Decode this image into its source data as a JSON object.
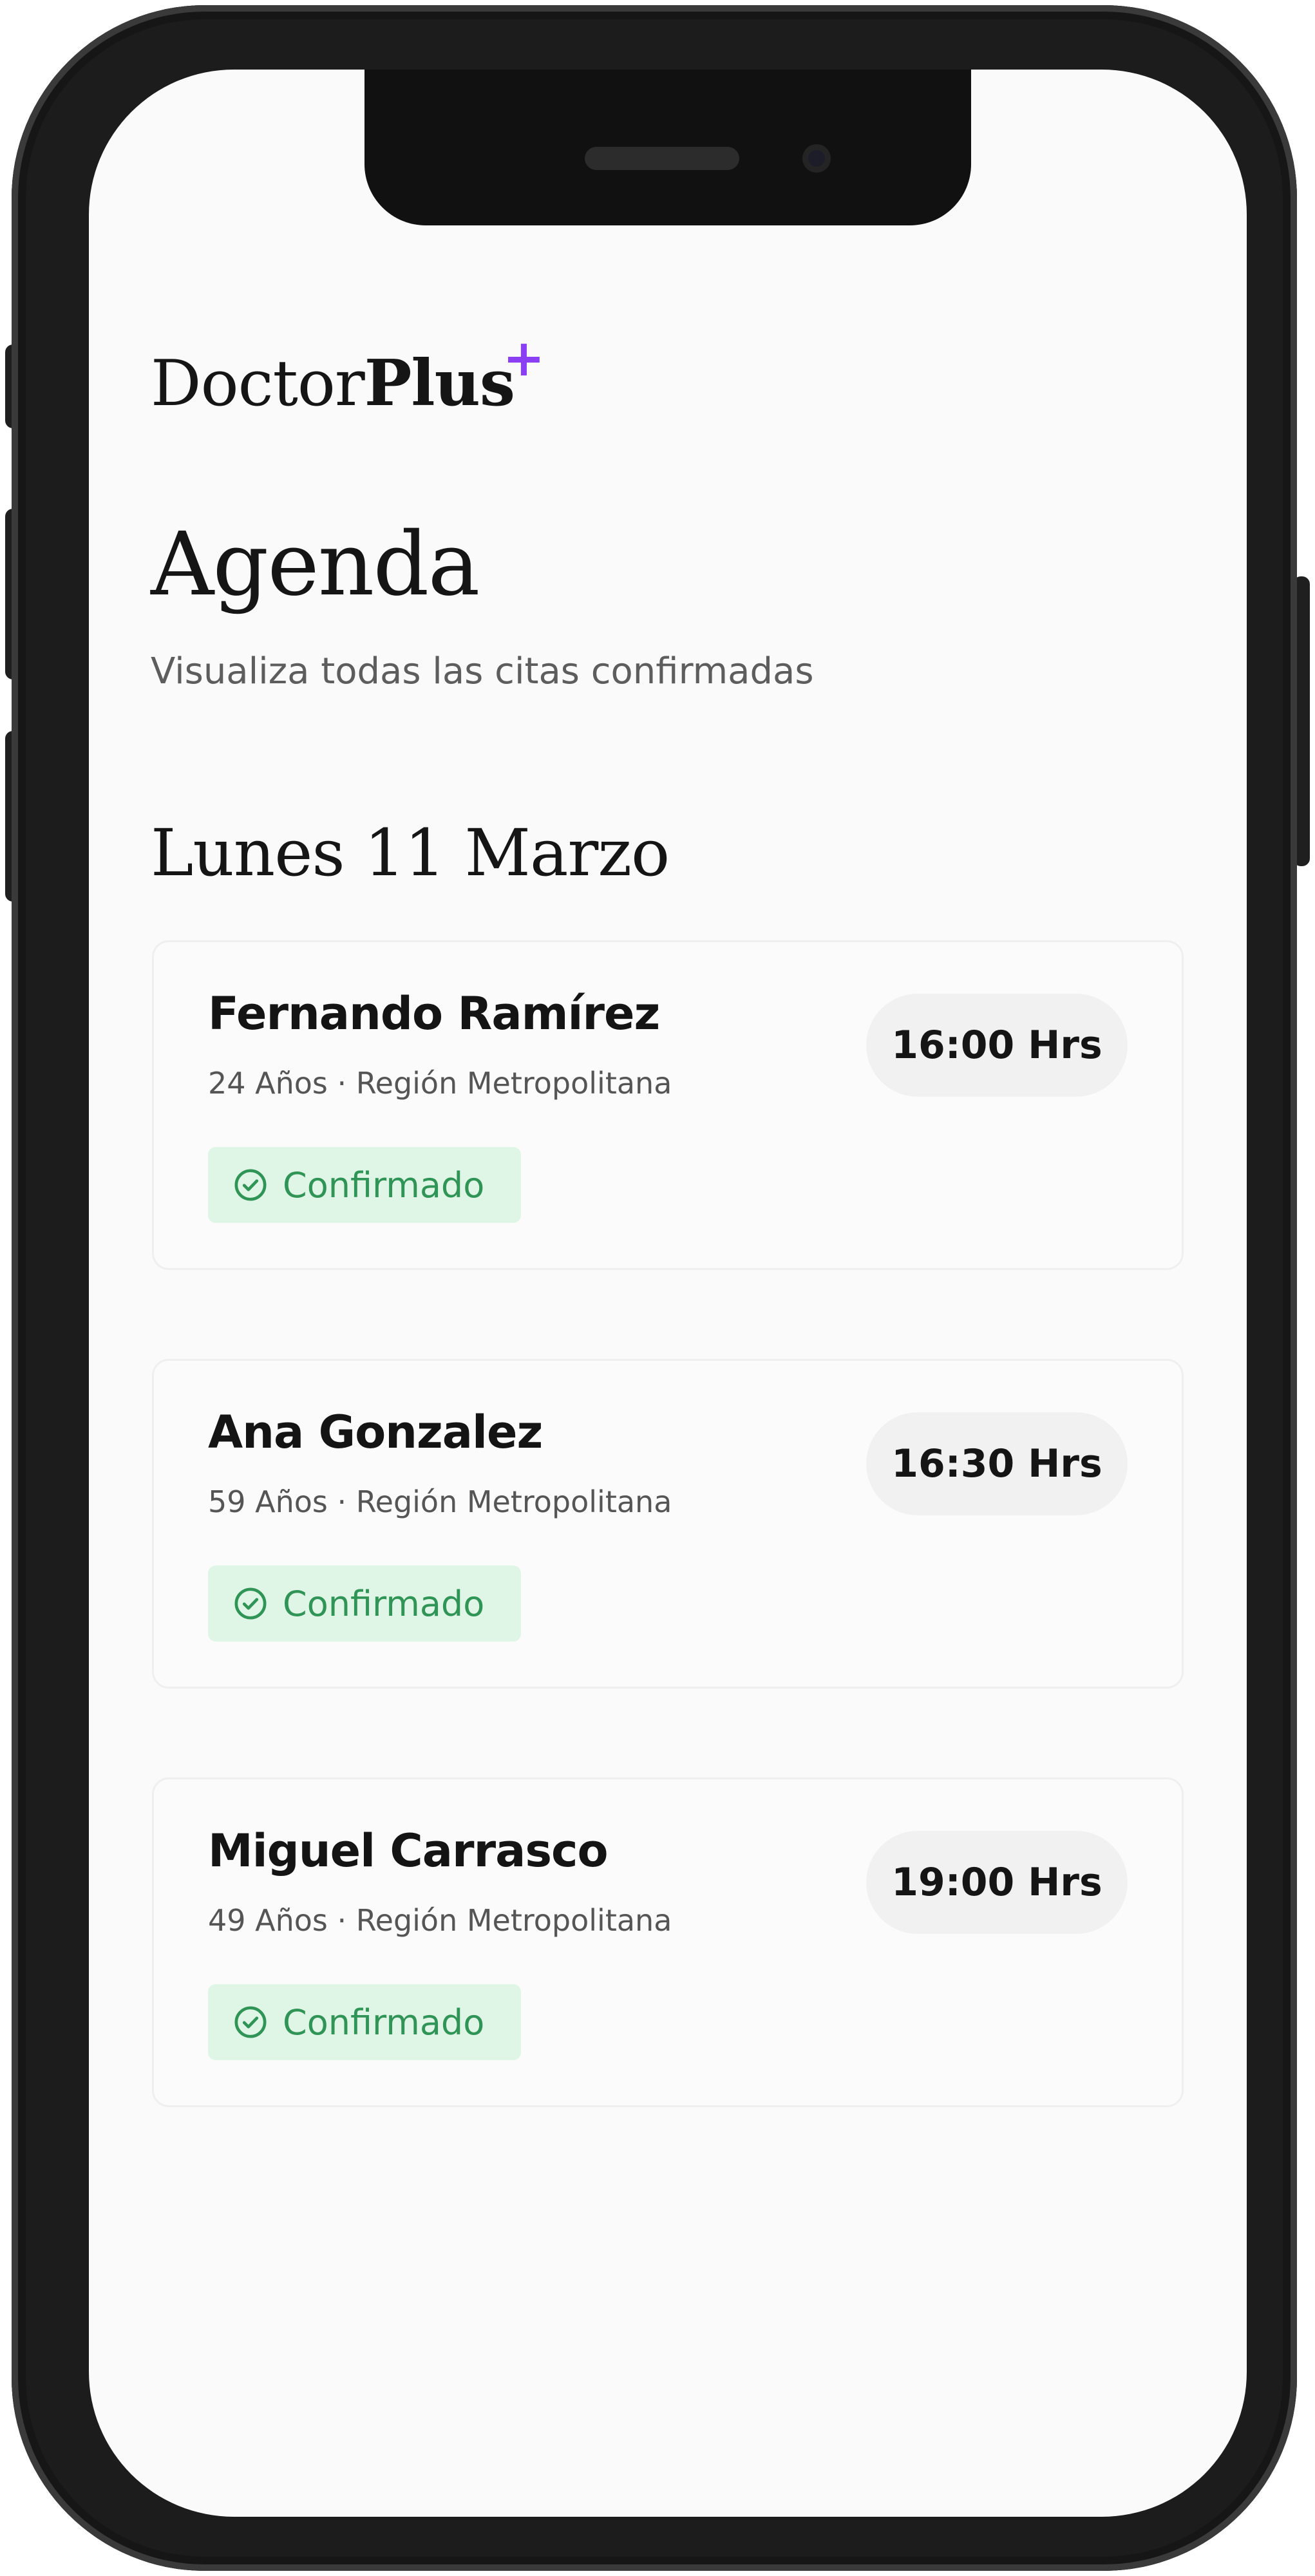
{
  "app": {
    "logo_regular": "Doctor",
    "logo_bold": "Plus",
    "logo_mark": "+",
    "accent_color": "#8b3ff5"
  },
  "header": {
    "title": "Agenda",
    "subtitle": "Visualiza todas las citas confirmadas"
  },
  "schedule": {
    "date_heading": "Lunes 11 Marzo",
    "appointments": [
      {
        "name": "Fernando Ramírez",
        "details": "24 Años · Región Metropolitana",
        "time": "16:00 Hrs",
        "status": "Confirmado",
        "status_icon": "check-circle-icon"
      },
      {
        "name": "Ana Gonzalez",
        "details": "59 Años · Región Metropolitana",
        "time": "16:30 Hrs",
        "status": "Confirmado",
        "status_icon": "check-circle-icon"
      },
      {
        "name": "Miguel Carrasco",
        "details": "49 Años · Región Metropolitana",
        "time": "19:00 Hrs",
        "status": "Confirmado",
        "status_icon": "check-circle-icon"
      }
    ]
  },
  "colors": {
    "status_confirmed_bg": "#dff6e6",
    "status_confirmed_text": "#2f9456"
  }
}
